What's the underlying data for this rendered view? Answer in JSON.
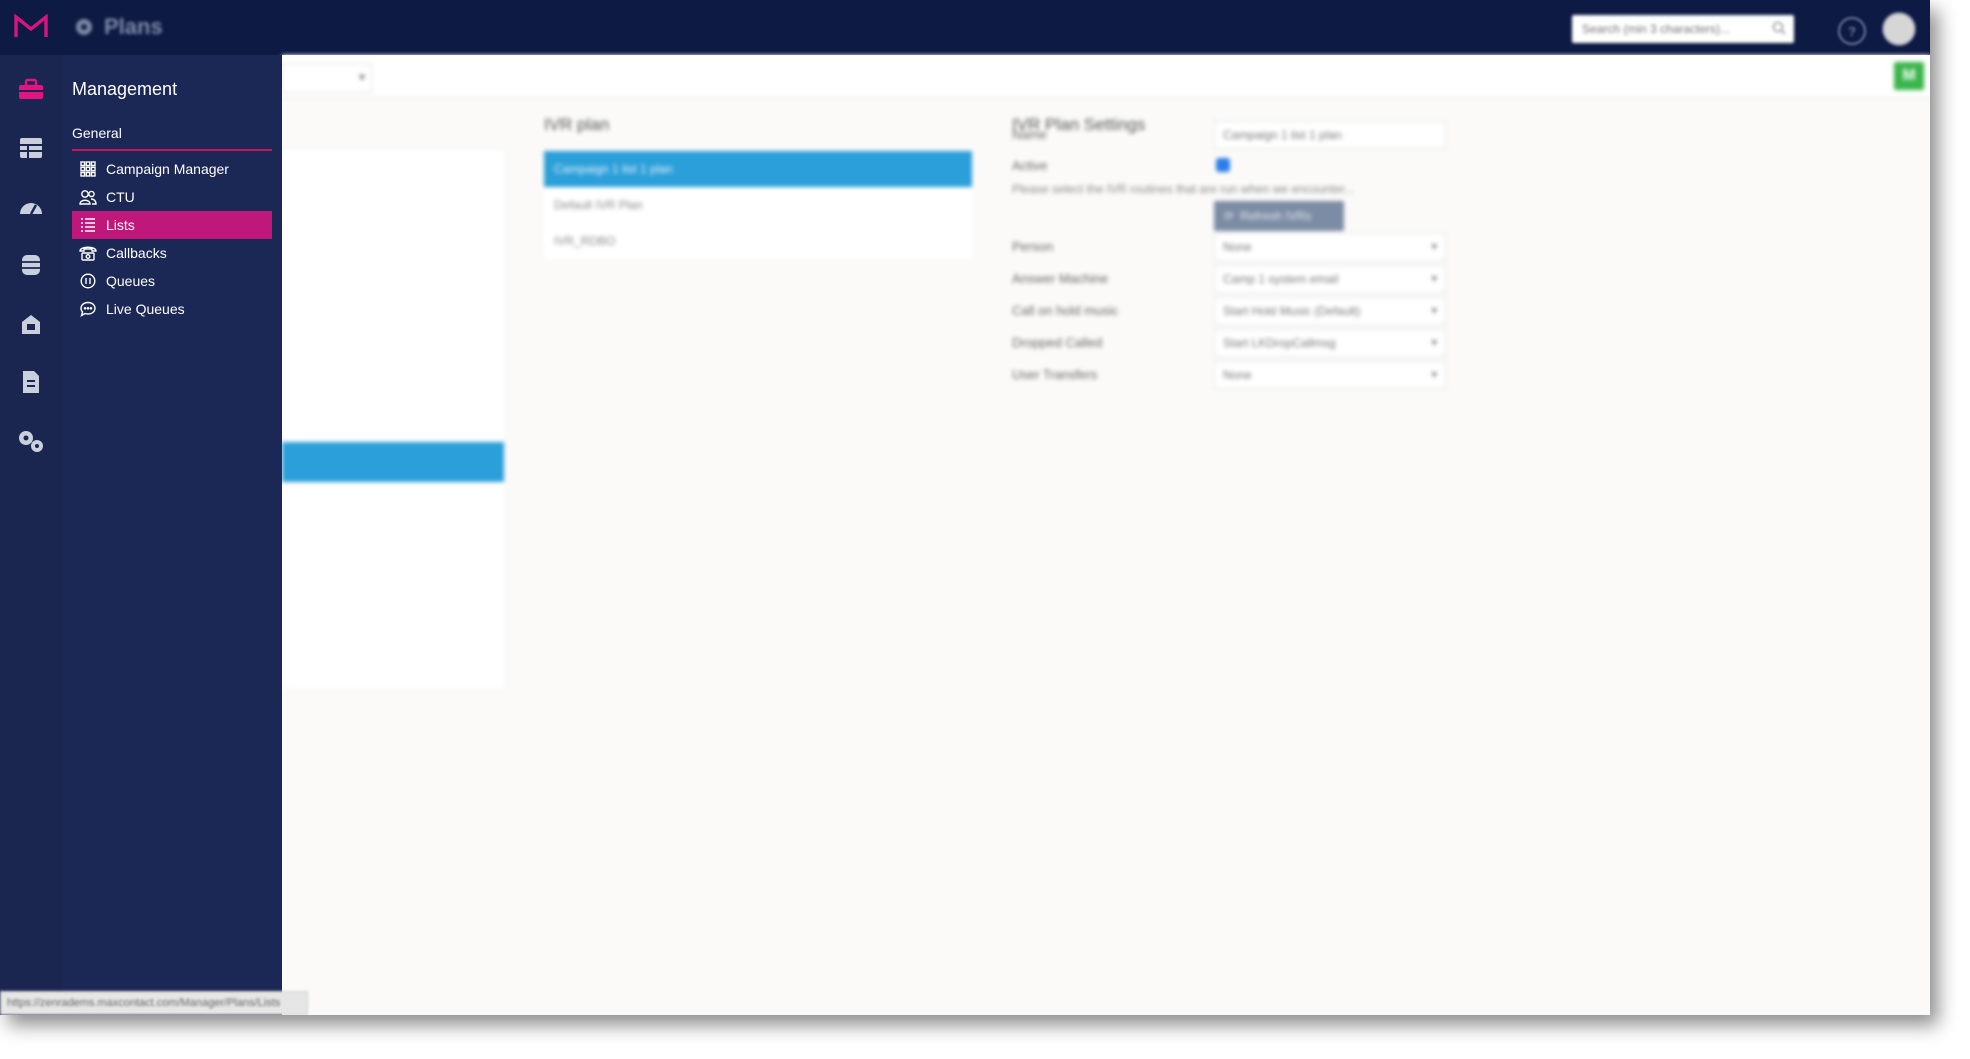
{
  "topbar": {
    "title": "Plans",
    "search_placeholder": "Search (min 3 characters)..."
  },
  "flyout": {
    "heading": "Management",
    "section": "General",
    "items": [
      {
        "label": "Campaign Manager",
        "icon": "grid-icon"
      },
      {
        "label": "CTU",
        "icon": "users-icon"
      },
      {
        "label": "Lists",
        "icon": "list-icon",
        "active": true
      },
      {
        "label": "Callbacks",
        "icon": "phone-icon"
      },
      {
        "label": "Queues",
        "icon": "pause-circle-icon"
      },
      {
        "label": "Live Queues",
        "icon": "chat-icon"
      }
    ],
    "status_url": "https://zenradems.maxcontact.com/Manager/Plans/Lists"
  },
  "toolbar": {
    "avatar_initial": "M"
  },
  "plans": {
    "title": "IVR plan",
    "items": [
      "Campaign 1 list 1 plan",
      "Default IVR Plan",
      "IVR_RDBO"
    ]
  },
  "settings": {
    "title": "IVR Plan Settings",
    "name_label": "Name",
    "name_value": "Campaign 1 list 1 plan",
    "active_label": "Active",
    "hint": "Please select the IVR routines that are run when we encounter...",
    "refresh_label": "Refresh IVRs",
    "fields": [
      {
        "label": "Person",
        "value": "None"
      },
      {
        "label": "Answer Machine",
        "value": "Camp 1 system email"
      },
      {
        "label": "Call on hold music",
        "value": "Start Hold Music (Default)"
      },
      {
        "label": "Dropped Called",
        "value": "Start LKDropCallmsg"
      },
      {
        "label": "User Transfers",
        "value": "None"
      }
    ]
  },
  "colors": {
    "topbar": "#0d1a44",
    "rail": "#1a2550",
    "flyout": "#1b2754",
    "accent_magenta": "#c0177b",
    "selection_blue": "#2b9fd9",
    "green": "#39b54a"
  }
}
